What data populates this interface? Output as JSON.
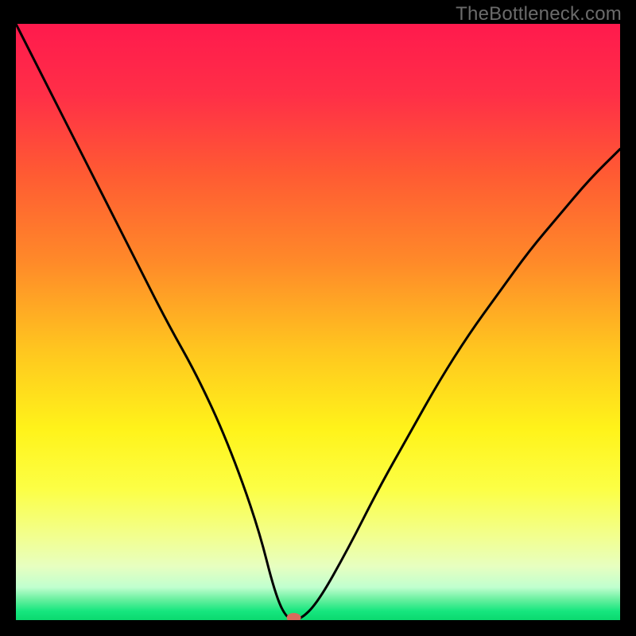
{
  "watermark": "TheBottleneck.com",
  "chart_data": {
    "type": "line",
    "title": "",
    "xlabel": "",
    "ylabel": "",
    "xlim": [
      0,
      100
    ],
    "ylim": [
      0,
      100
    ],
    "background_gradient_stops": [
      {
        "offset": 0.0,
        "color": "#ff1a4d"
      },
      {
        "offset": 0.12,
        "color": "#ff2f47"
      },
      {
        "offset": 0.25,
        "color": "#ff5a33"
      },
      {
        "offset": 0.4,
        "color": "#ff8a29"
      },
      {
        "offset": 0.55,
        "color": "#ffc71f"
      },
      {
        "offset": 0.68,
        "color": "#fff31a"
      },
      {
        "offset": 0.78,
        "color": "#fcff45"
      },
      {
        "offset": 0.86,
        "color": "#f2ff8f"
      },
      {
        "offset": 0.91,
        "color": "#e7ffc0"
      },
      {
        "offset": 0.945,
        "color": "#c0ffcf"
      },
      {
        "offset": 0.965,
        "color": "#6af0a0"
      },
      {
        "offset": 0.985,
        "color": "#16e67e"
      },
      {
        "offset": 1.0,
        "color": "#0bd96f"
      }
    ],
    "series": [
      {
        "name": "bottleneck-curve",
        "x": [
          0,
          5,
          10,
          15,
          20,
          25,
          30,
          35,
          40,
          43,
          45,
          47,
          50,
          55,
          60,
          65,
          70,
          75,
          80,
          85,
          90,
          95,
          100
        ],
        "y": [
          100,
          90,
          80,
          70,
          60,
          50,
          41,
          30,
          16,
          4,
          0,
          0,
          3,
          12,
          22,
          31,
          40,
          48,
          55,
          62,
          68,
          74,
          79
        ]
      }
    ],
    "marker": {
      "x": 46,
      "y": 0,
      "color": "#d86b5c",
      "rx": 9,
      "ry": 6
    },
    "curve_stroke": "#000000",
    "curve_width": 3
  }
}
